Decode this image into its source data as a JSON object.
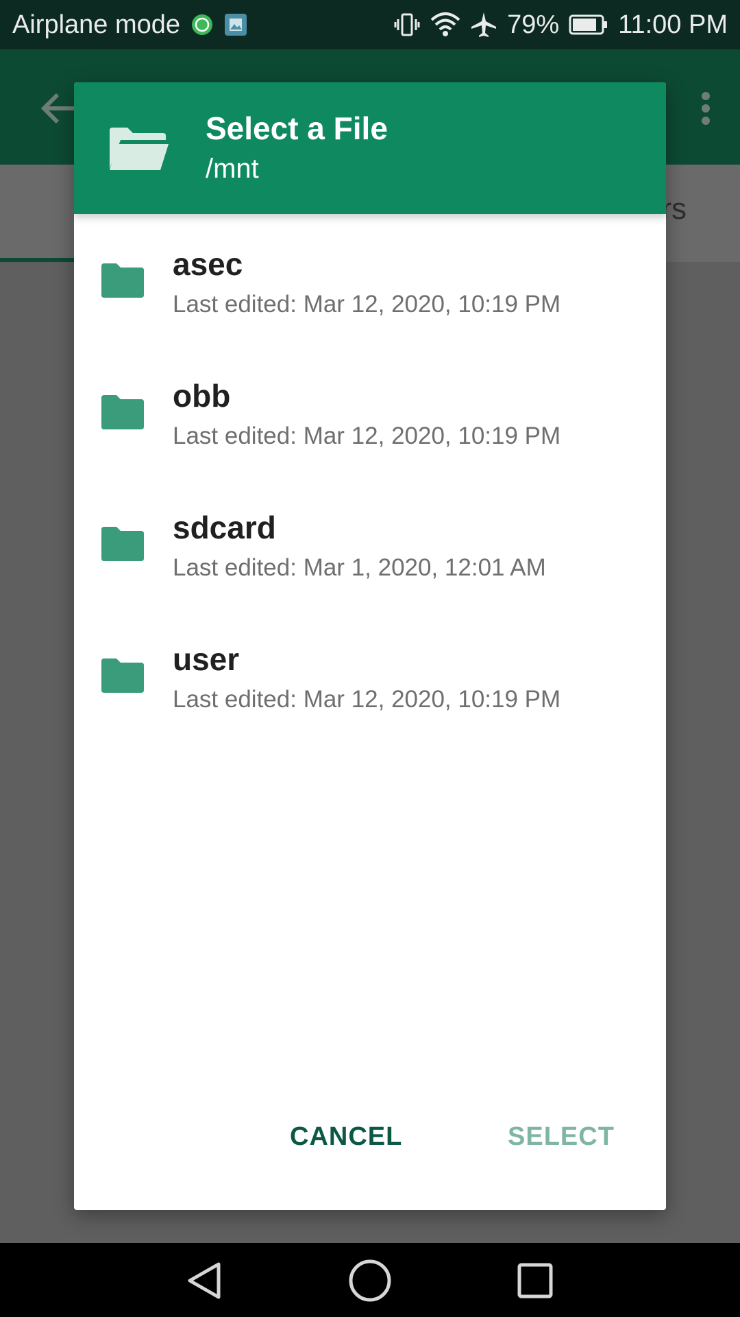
{
  "status_bar": {
    "left_text": "Airplane mode",
    "battery_percent": "79%",
    "time": "11:00 PM",
    "icons": [
      "whatsapp-icon",
      "gallery-icon",
      "vibrate-icon",
      "wifi-icon",
      "airplane-icon",
      "battery-icon"
    ]
  },
  "background_app": {
    "tab_fragment": "rs"
  },
  "dialog": {
    "title": "Select a File",
    "path": "/mnt",
    "items": [
      {
        "name": "asec",
        "meta": "Last edited: Mar 12, 2020, 10:19 PM"
      },
      {
        "name": "obb",
        "meta": "Last edited: Mar 12, 2020, 10:19 PM"
      },
      {
        "name": "sdcard",
        "meta": "Last edited: Mar 1, 2020, 12:01 AM"
      },
      {
        "name": "user",
        "meta": "Last edited: Mar 12, 2020, 10:19 PM"
      }
    ],
    "cancel_label": "CANCEL",
    "select_label": "SELECT"
  },
  "colors": {
    "header": "#0f8a60",
    "folder": "#3a9c7b",
    "cancel": "#0b5845",
    "select_disabled": "#7fb5a5"
  }
}
